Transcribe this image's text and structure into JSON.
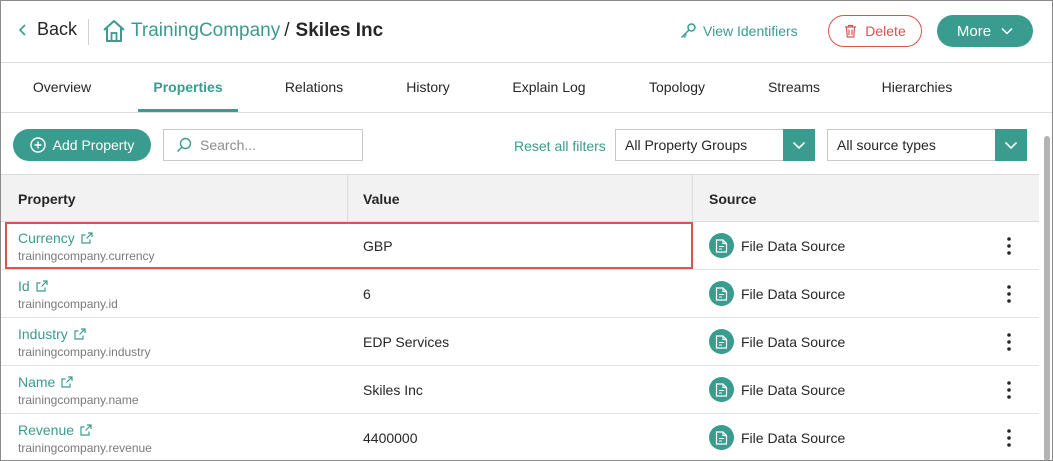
{
  "header": {
    "back_label": "Back",
    "breadcrumb_link": "TrainingCompany",
    "breadcrumb_sep": "/",
    "breadcrumb_current": "Skiles Inc",
    "view_identifiers_label": "View Identifiers",
    "delete_label": "Delete",
    "more_label": "More"
  },
  "tabs": [
    {
      "label": "Overview",
      "active": false
    },
    {
      "label": "Properties",
      "active": true
    },
    {
      "label": "Relations",
      "active": false
    },
    {
      "label": "History",
      "active": false
    },
    {
      "label": "Explain Log",
      "active": false
    },
    {
      "label": "Topology",
      "active": false
    },
    {
      "label": "Streams",
      "active": false
    },
    {
      "label": "Hierarchies",
      "active": false
    }
  ],
  "toolbar": {
    "add_property_label": "Add Property",
    "search_placeholder": "Search...",
    "reset_filters_label": "Reset all filters",
    "property_groups_value": "All Property Groups",
    "source_types_value": "All source types"
  },
  "table": {
    "columns": [
      "Property",
      "Value",
      "Source"
    ],
    "rows": [
      {
        "name": "Currency",
        "key": "trainingcompany.currency",
        "value": "GBP",
        "source": "File Data Source",
        "highlighted": true
      },
      {
        "name": "Id",
        "key": "trainingcompany.id",
        "value": "6",
        "source": "File Data Source",
        "highlighted": false
      },
      {
        "name": "Industry",
        "key": "trainingcompany.industry",
        "value": "EDP Services",
        "source": "File Data Source",
        "highlighted": false
      },
      {
        "name": "Name",
        "key": "trainingcompany.name",
        "value": "Skiles Inc",
        "source": "File Data Source",
        "highlighted": false
      },
      {
        "name": "Revenue",
        "key": "trainingcompany.revenue",
        "value": "4400000",
        "source": "File Data Source",
        "highlighted": false
      }
    ]
  },
  "colors": {
    "accent": "#3a9b8f",
    "danger": "#d9534f",
    "header_bg": "#f2f2f2"
  }
}
